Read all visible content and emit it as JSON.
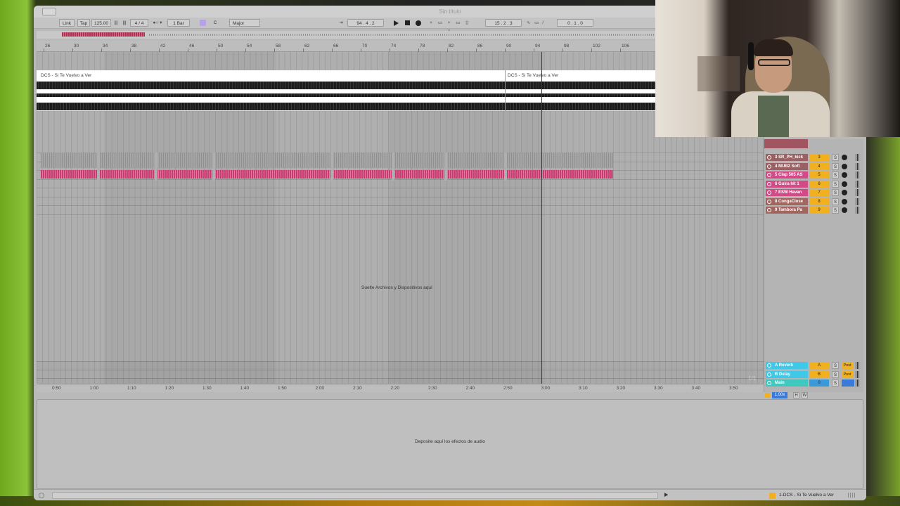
{
  "title": "Sin título",
  "toolbar": {
    "link": "Link",
    "tap": "Tap",
    "tempo": "125.00",
    "time_sig": "4 / 4",
    "quantize": "1 Bar",
    "key": "C",
    "scale": "Major",
    "position": "94 .  4 .  2",
    "loop_start": "15 .  2 .  3",
    "loop_length": "0 .  1 .  0"
  },
  "ruler": [
    "26",
    "30",
    "34",
    "38",
    "42",
    "46",
    "50",
    "54",
    "58",
    "62",
    "66",
    "70",
    "74",
    "78",
    "82",
    "86",
    "90",
    "94",
    "98",
    "102",
    "106"
  ],
  "clips": [
    {
      "name": "DCS - Si Te Vuelvo a Ver"
    },
    {
      "name": "DCS - Si Te Vuelvo a Ver"
    }
  ],
  "drop_text": "Suelte Archivos y Dispositivos aquí",
  "timeline": [
    "0:50",
    "1:00",
    "1:10",
    "1:20",
    "1:30",
    "1:40",
    "1:50",
    "2:00",
    "2:10",
    "2:20",
    "2:30",
    "2:40",
    "2:50",
    "3:00",
    "3:10",
    "3:20",
    "3:30",
    "3:40",
    "3:50"
  ],
  "tracks": [
    {
      "name": "3 SR_PH_kick",
      "num": "3",
      "color": "#9a6062"
    },
    {
      "name": "4 MUB2 Soft",
      "num": "4",
      "color": "#9a6062"
    },
    {
      "name": "5 Clap 505 AS",
      "num": "5",
      "color": "#d24b86"
    },
    {
      "name": "6 Guira hit 1",
      "num": "6",
      "color": "#d24b86"
    },
    {
      "name": "7 ESW Havan",
      "num": "7",
      "color": "#d24b86"
    },
    {
      "name": "8 CongaClose",
      "num": "8",
      "color": "#a3665f"
    },
    {
      "name": "9 Tambora Pa",
      "num": "9",
      "color": "#a3665f"
    }
  ],
  "returns": [
    {
      "name": "A Reverb",
      "num": "A",
      "post": "Post",
      "color": "#3fc8e8"
    },
    {
      "name": "B Delay",
      "num": "B",
      "post": "Post",
      "color": "#3fc8e8"
    },
    {
      "name": "Main",
      "num": "0",
      "color": "#3fc8c0"
    }
  ],
  "zoom": "1.00x",
  "h_label": "H",
  "w_label": "W",
  "fraction": "1/1",
  "device_text": "Deposite aquí los efectos de audio",
  "status_track": "1-DCS - Si Te Vuelvo a Ver"
}
